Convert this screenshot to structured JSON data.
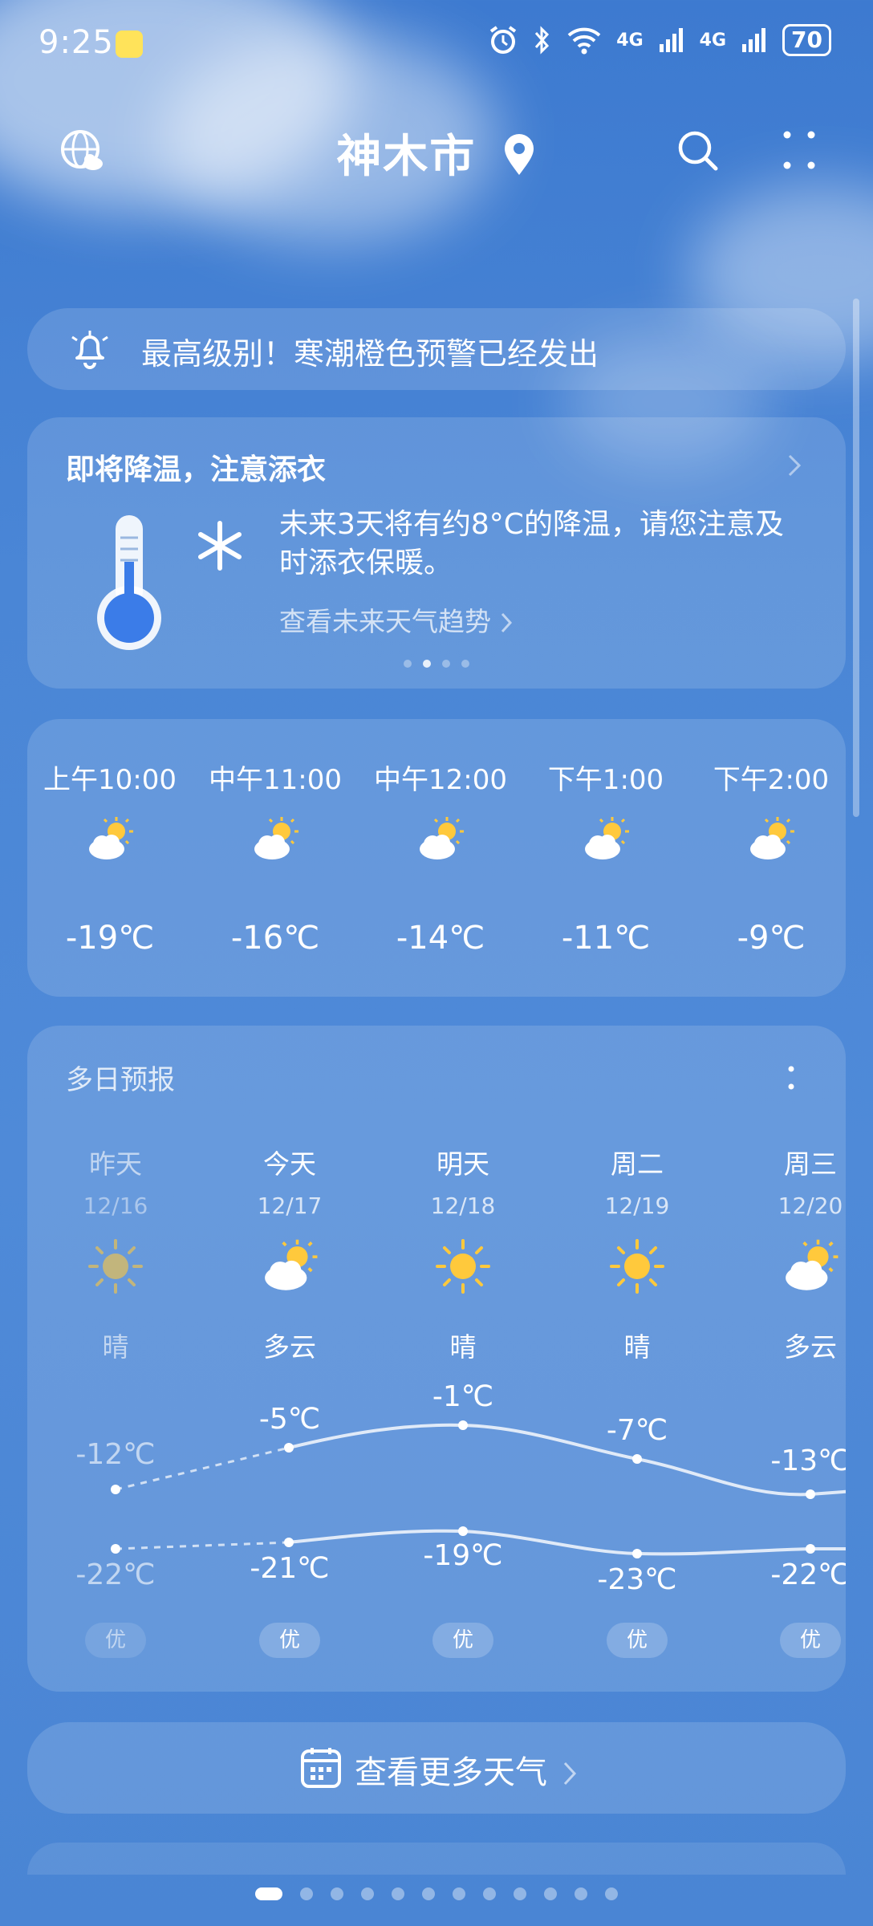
{
  "status_bar": {
    "time": "9:25",
    "net1": "4G",
    "net2": "4G",
    "battery": "70"
  },
  "header": {
    "city": "神木市",
    "icons": [
      "globe-cloud-icon",
      "location-pin-icon",
      "search-icon",
      "more-dots-icon"
    ]
  },
  "alert": {
    "text": "最高级别！寒潮橙色预警已经发出",
    "icon": "bell-icon"
  },
  "tip_card": {
    "title": "即将降温，注意添衣",
    "body": "未来3天将有约8°C的降温，请您注意及时添衣保暖。",
    "link": "查看未来天气趋势",
    "page_count": 4,
    "active_page": 1
  },
  "hourly": [
    {
      "time": "上午10:00",
      "temp": "-19℃",
      "icon": "partly-cloudy-icon"
    },
    {
      "time": "中午11:00",
      "temp": "-16℃",
      "icon": "partly-cloudy-icon"
    },
    {
      "time": "中午12:00",
      "temp": "-14℃",
      "icon": "partly-cloudy-icon"
    },
    {
      "time": "下午1:00",
      "temp": "-11℃",
      "icon": "partly-cloudy-icon"
    },
    {
      "time": "下午2:00",
      "temp": "-9℃",
      "icon": "partly-cloudy-icon"
    }
  ],
  "daily": {
    "title": "多日预报",
    "days": [
      {
        "name": "昨天",
        "date": "12/16",
        "desc": "晴",
        "icon": "sunny-icon",
        "high": "-12℃",
        "low": "-22℃",
        "aqi": "优"
      },
      {
        "name": "今天",
        "date": "12/17",
        "desc": "多云",
        "icon": "partly-cloudy-icon",
        "high": "-5℃",
        "low": "-21℃",
        "aqi": "优"
      },
      {
        "name": "明天",
        "date": "12/18",
        "desc": "晴",
        "icon": "sunny-icon",
        "high": "-1℃",
        "low": "-19℃",
        "aqi": "优"
      },
      {
        "name": "周二",
        "date": "12/19",
        "desc": "晴",
        "icon": "sunny-icon",
        "high": "-7℃",
        "low": "-23℃",
        "aqi": "优"
      },
      {
        "name": "周三",
        "date": "12/20",
        "desc": "多云",
        "icon": "partly-cloudy-icon",
        "high": "-13℃",
        "low": "-22℃",
        "aqi": "优"
      }
    ]
  },
  "more": {
    "text": "查看更多天气"
  },
  "pager": {
    "count": 12,
    "active": 0
  }
}
